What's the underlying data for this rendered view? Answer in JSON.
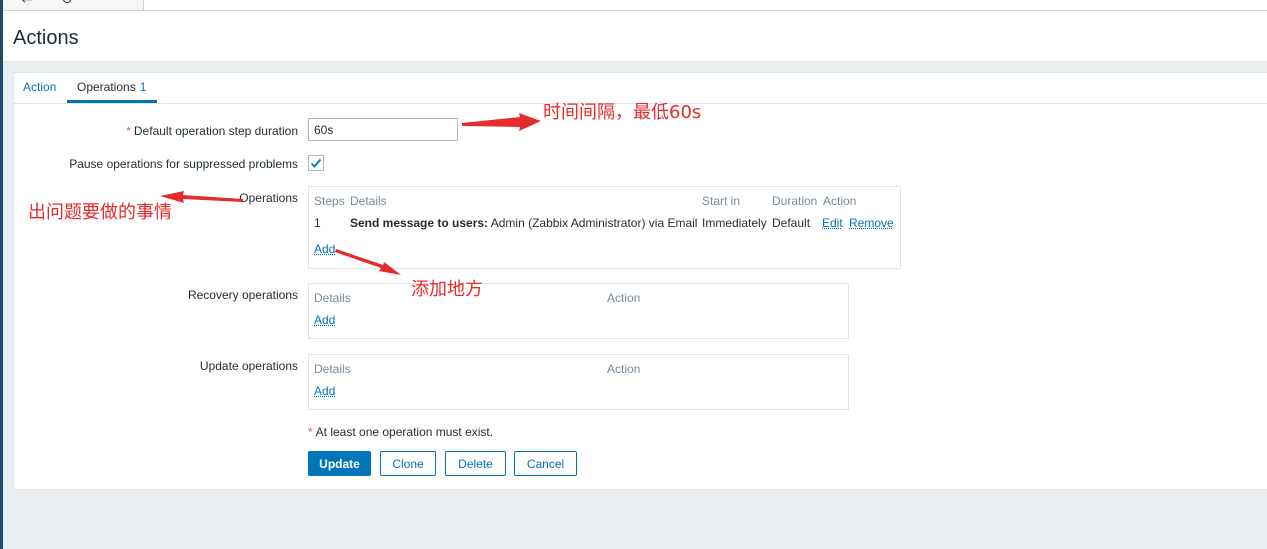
{
  "browser": {
    "back_icon": "back-arrow-icon",
    "refresh_icon": "refresh-icon"
  },
  "page": {
    "title": "Actions"
  },
  "tabs": [
    {
      "label": "Action",
      "active": false
    },
    {
      "label": "Operations",
      "count": "1",
      "active": true
    }
  ],
  "form": {
    "step_duration": {
      "label": "Default operation step duration",
      "value": "60s",
      "required": "*"
    },
    "pause_suppressed": {
      "label": "Pause operations for suppressed problems",
      "checked": true
    },
    "operations": {
      "label": "Operations",
      "headers": [
        "Steps",
        "Details",
        "Start in",
        "Duration",
        "Action"
      ],
      "rows": [
        {
          "steps": "1",
          "details_bold": "Send message to users:",
          "details_rest": " Admin (Zabbix Administrator) via Email",
          "start_in": "Immediately",
          "duration": "Default",
          "edit": "Edit",
          "remove": "Remove"
        }
      ],
      "add": "Add"
    },
    "recovery_operations": {
      "label": "Recovery operations",
      "headers": [
        "Details",
        "Action"
      ],
      "add": "Add"
    },
    "update_operations": {
      "label": "Update operations",
      "headers": [
        "Details",
        "Action"
      ],
      "add": "Add"
    },
    "note": {
      "required": "*",
      "text": "At least one operation must exist."
    }
  },
  "buttons": {
    "update": "Update",
    "clone": "Clone",
    "delete": "Delete",
    "cancel": "Cancel"
  },
  "annotations": {
    "interval": "时间间隔，最低60s",
    "problem": "出问题要做的事情",
    "add_place": "添加地方"
  },
  "colors": {
    "accent": "#0275b8",
    "annotation": "#e52b2b",
    "required": "#e45959"
  }
}
